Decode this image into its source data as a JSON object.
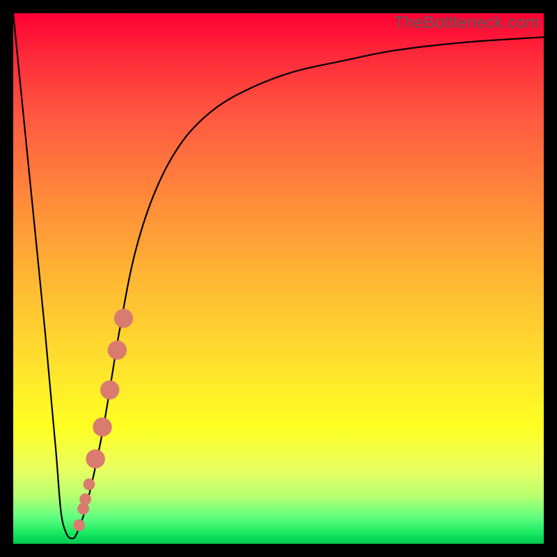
{
  "watermark": "TheBottleneck.com",
  "colors": {
    "frame": "#000000",
    "curve_stroke": "#000000",
    "marker_fill": "#d97b6f",
    "gradient_top": "#ff0033",
    "gradient_bottom": "#00c850"
  },
  "chart_data": {
    "type": "line",
    "title": "",
    "xlabel": "",
    "ylabel": "",
    "xlim": [
      0,
      100
    ],
    "ylim": [
      0,
      100
    ],
    "grid": false,
    "legend": false,
    "series": [
      {
        "name": "bottleneck-curve",
        "x": [
          0,
          3,
          6,
          8,
          9,
          10,
          11,
          12,
          14,
          17,
          20,
          23,
          27,
          32,
          38,
          45,
          53,
          62,
          72,
          85,
          100
        ],
        "y": [
          100,
          70,
          40,
          18,
          6,
          2,
          1,
          2,
          8,
          22,
          40,
          55,
          67,
          76,
          82,
          86,
          89,
          91,
          93,
          94.5,
          95.5
        ]
      }
    ],
    "highlight_points": {
      "name": "salmon-markers",
      "points": [
        {
          "x": 12.4,
          "y": 3.5,
          "r": 1.1
        },
        {
          "x": 13.2,
          "y": 6.6,
          "r": 1.1
        },
        {
          "x": 13.6,
          "y": 8.4,
          "r": 1.1
        },
        {
          "x": 14.3,
          "y": 11.2,
          "r": 1.1
        },
        {
          "x": 15.5,
          "y": 16.0,
          "r": 1.8
        },
        {
          "x": 16.8,
          "y": 22.0,
          "r": 1.8
        },
        {
          "x": 18.2,
          "y": 29.0,
          "r": 1.8
        },
        {
          "x": 19.6,
          "y": 36.5,
          "r": 1.8
        },
        {
          "x": 20.8,
          "y": 42.5,
          "r": 1.8
        }
      ]
    }
  }
}
